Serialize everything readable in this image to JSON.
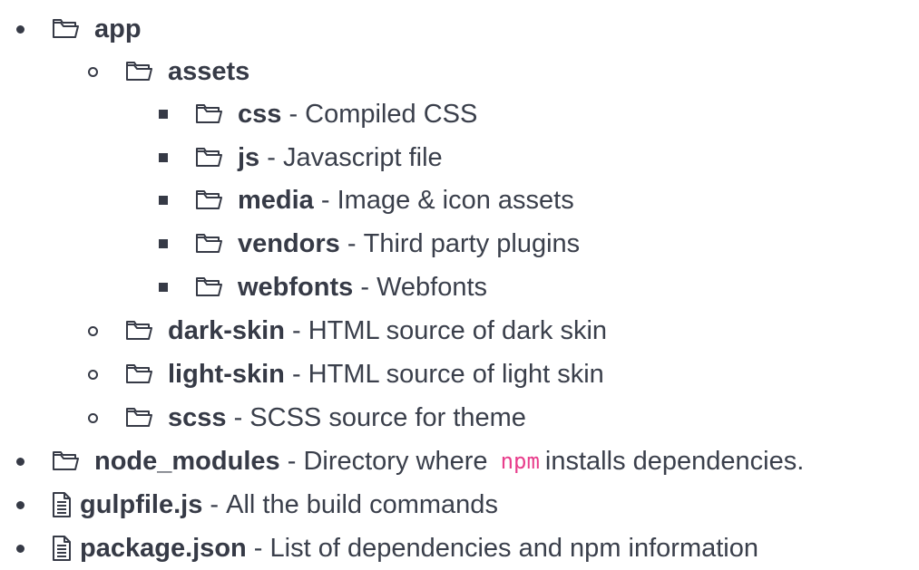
{
  "tree": [
    {
      "name": "app",
      "sep": "",
      "desc": ""
    },
    {
      "name": "assets",
      "sep": "",
      "desc": ""
    },
    {
      "name": "css",
      "sep": " - ",
      "desc": "Compiled CSS"
    },
    {
      "name": "js",
      "sep": " - ",
      "desc": "Javascript file"
    },
    {
      "name": "media",
      "sep": " - ",
      "desc": "Image & icon assets"
    },
    {
      "name": "vendors",
      "sep": " - ",
      "desc": "Third party plugins"
    },
    {
      "name": "webfonts",
      "sep": " - ",
      "desc": "Webfonts"
    },
    {
      "name": "dark-skin",
      "sep": " - ",
      "desc": "HTML source of dark skin"
    },
    {
      "name": "light-skin",
      "sep": " - ",
      "desc": "HTML source of light skin"
    },
    {
      "name": "scss",
      "sep": " - ",
      "desc": "SCSS source for theme"
    },
    {
      "name": "node_modules",
      "sep": " - ",
      "desc_before": "Directory where ",
      "code": "npm",
      "desc_after": "installs dependencies."
    },
    {
      "name": "gulpfile.js",
      "sep": " - ",
      "desc": "All the build commands"
    },
    {
      "name": "package.json",
      "sep": " - ",
      "desc": "List of dependencies and npm information"
    }
  ],
  "icons": {
    "folder": "folder-icon",
    "file": "file-icon"
  },
  "colors": {
    "text": "#3a3f4b",
    "bold": "#363a46",
    "code": "#e83e8c"
  }
}
